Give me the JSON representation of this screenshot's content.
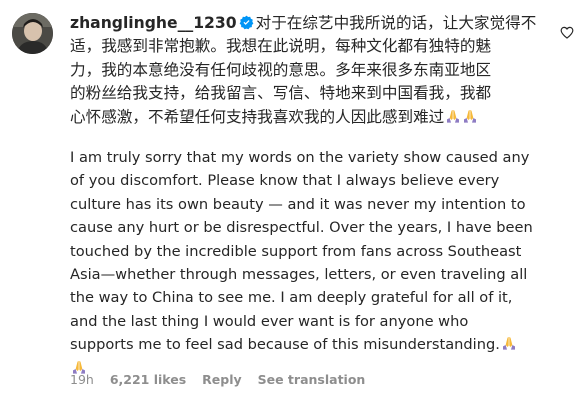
{
  "comment": {
    "username": "zhanglinghe__1230",
    "verified": true,
    "zh_lines": [
      "对于在综艺中我所说的话，让大家觉得不",
      "适，我感到非常抱歉。我想在此说明，每种文化都有独特的魅",
      "力，我的本意绝没有任何歧视的意思。多年来很多东南亚地区",
      "的粉丝给我支持，给我留言、写信、特地来到中国看我，我都",
      "心怀感激，不希望任何支持我喜欢我的人因此感到难过"
    ],
    "en_lines": [
      "I am truly sorry that my words on the variety show caused any",
      "of you discomfort. Please know that I always believe every",
      "culture has its own beauty — and it was never my intention to",
      "cause any hurt or be disrespectful. Over the years, I have been",
      "touched by the incredible support from fans across Southeast",
      "Asia—whether through messages, letters, or even traveling all",
      "the way to China to see me. I am deeply grateful for all of it,",
      "and the last thing I would ever want is for anyone who",
      "supports me to feel sad because of this misunderstanding."
    ],
    "emoji": "folded-hands",
    "time": "19h",
    "likes": "6,221 likes",
    "reply_label": "Reply",
    "translation_label": "See translation"
  },
  "colors": {
    "text": "#262626",
    "meta": "#8e8e8e",
    "verified_blue": "#0095f6",
    "emoji_skin": "#f6b93b",
    "emoji_sleeve": "#8e7cc3"
  },
  "icons": [
    "avatar",
    "verified-badge-icon",
    "folded-hands-icon",
    "heart-icon"
  ]
}
